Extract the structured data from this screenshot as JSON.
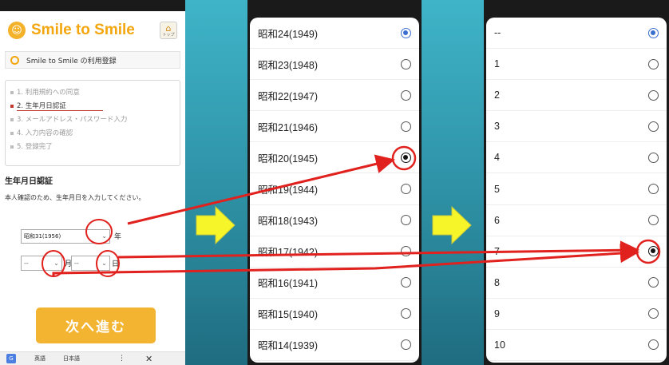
{
  "registration": {
    "brand": "Smile to Smile",
    "home_label": "トップ",
    "page_title": "Smile to Smile の利用登録",
    "steps": [
      {
        "label": "1. 利用規約への同意"
      },
      {
        "label": "2. 生年月日認証"
      },
      {
        "label": "3. メールアドレス・パスワード入力"
      },
      {
        "label": "4. 入力内容の確認"
      },
      {
        "label": "5. 登録完了"
      }
    ],
    "section_title": "生年月日認証",
    "description": "本人確認のため、生年月日を入力してください。",
    "year_value": "昭和31(1956)",
    "year_unit": "年",
    "month_value": "--",
    "month_unit": "月",
    "day_value": "--",
    "day_unit": "日",
    "next_button": "次へ進む"
  },
  "translate_bar": {
    "english": "英語",
    "japanese": "日本語",
    "more": "⋮",
    "close": "✕"
  },
  "year_picker": {
    "items": [
      {
        "label": "昭和24(1949)",
        "state": "selected"
      },
      {
        "label": "昭和23(1948)",
        "state": "off"
      },
      {
        "label": "昭和22(1947)",
        "state": "off"
      },
      {
        "label": "昭和21(1946)",
        "state": "off"
      },
      {
        "label": "昭和20(1945)",
        "state": "marked"
      },
      {
        "label": "昭和19(1944)",
        "state": "off"
      },
      {
        "label": "昭和18(1943)",
        "state": "off"
      },
      {
        "label": "昭和17(1942)",
        "state": "off"
      },
      {
        "label": "昭和16(1941)",
        "state": "off"
      },
      {
        "label": "昭和15(1940)",
        "state": "off"
      },
      {
        "label": "昭和14(1939)",
        "state": "off"
      }
    ]
  },
  "day_picker": {
    "items": [
      {
        "label": "--",
        "state": "selected"
      },
      {
        "label": "1",
        "state": "off"
      },
      {
        "label": "2",
        "state": "off"
      },
      {
        "label": "3",
        "state": "off"
      },
      {
        "label": "4",
        "state": "off"
      },
      {
        "label": "5",
        "state": "off"
      },
      {
        "label": "6",
        "state": "off"
      },
      {
        "label": "7",
        "state": "marked"
      },
      {
        "label": "8",
        "state": "off"
      },
      {
        "label": "9",
        "state": "off"
      },
      {
        "label": "10",
        "state": "off"
      }
    ]
  },
  "colors": {
    "accent": "#f3a60e",
    "button": "#f3b431",
    "annotation_red": "#e0211d",
    "arrow_yellow": "#f5f52a",
    "radio_blue": "#3a6fd0"
  }
}
